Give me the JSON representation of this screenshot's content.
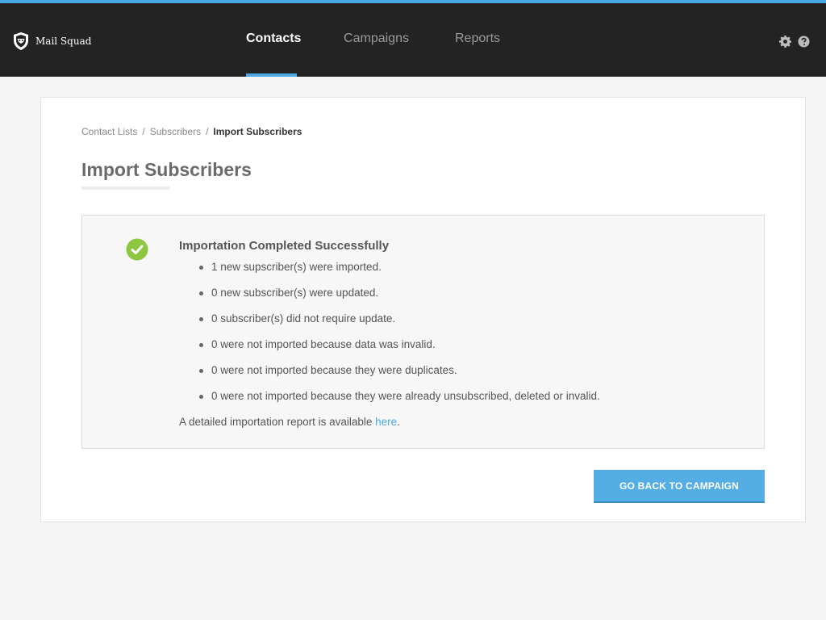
{
  "app": {
    "name": "Mail Squad"
  },
  "nav": {
    "items": [
      {
        "label": "Contacts",
        "active": true
      },
      {
        "label": "Campaigns",
        "active": false
      },
      {
        "label": "Reports",
        "active": false
      }
    ]
  },
  "header_icons": [
    "gear-icon",
    "help-icon"
  ],
  "breadcrumb": {
    "items": [
      "Contact Lists",
      "Subscribers",
      "Import Subscribers"
    ],
    "separator": "/"
  },
  "page": {
    "title": "Import Subscribers"
  },
  "result": {
    "heading": "Importation Completed Successfully",
    "items": [
      "1 new supscriber(s) were imported.",
      "0 new subscriber(s) were updated.",
      "0 subscriber(s) did not require update.",
      "0 were not imported because data was invalid.",
      "0 were not imported because they were duplicates.",
      "0 were not imported because they were already unsubscribed, deleted or invalid."
    ],
    "report_prefix": "A detailed importation report is available ",
    "report_link": "here",
    "report_suffix": "."
  },
  "actions": {
    "back_label": "GO BACK TO CAMPAIGN"
  },
  "colors": {
    "accent": "#4aa9e2",
    "topbar": "#232323",
    "success": "#8dc63f"
  }
}
